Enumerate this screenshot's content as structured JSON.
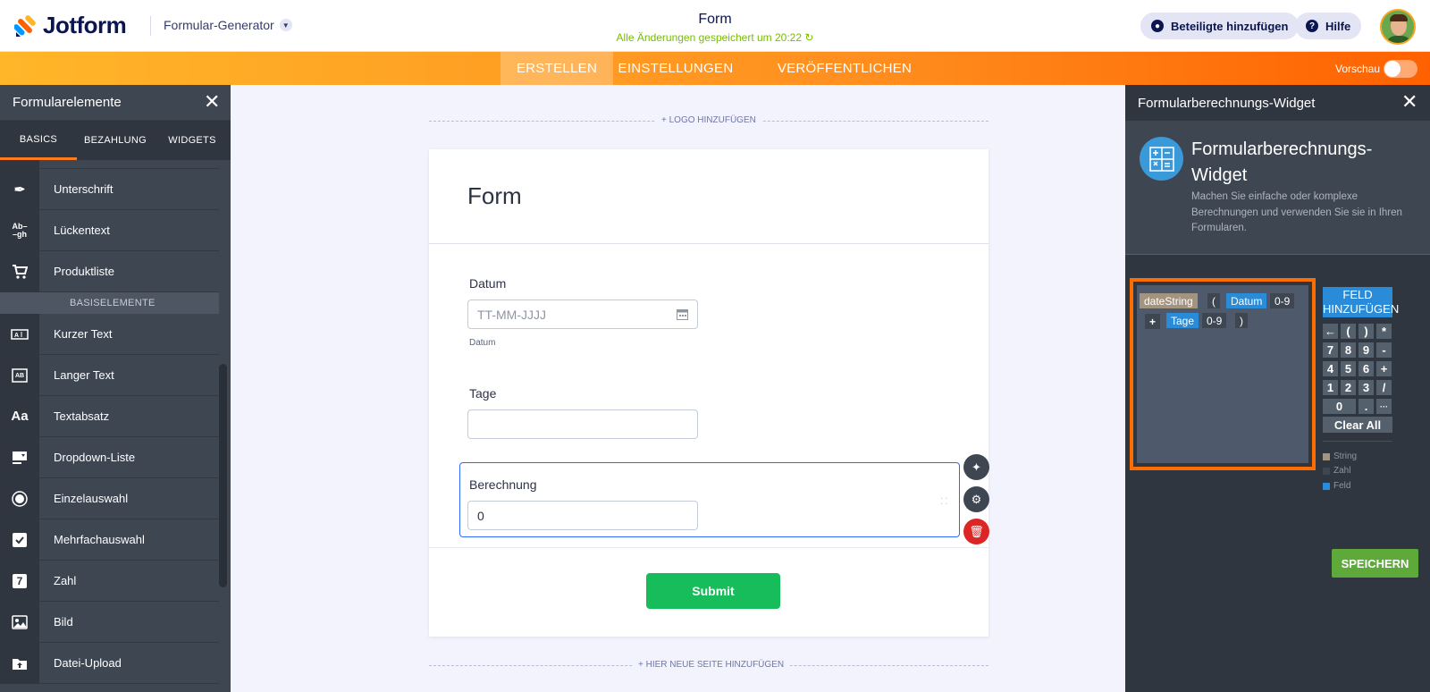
{
  "header": {
    "logo_text": "Jotform",
    "app_switcher": "Formular-Generator",
    "form_title": "Form",
    "save_status": "Alle Änderungen gespeichert um 20:22",
    "invite_label": "Beteiligte hinzufügen",
    "help_label": "Hilfe"
  },
  "nav": {
    "tabs": [
      "ERSTELLEN",
      "EINSTELLUNGEN",
      "VERÖFFENTLICHEN"
    ],
    "active_tab": "ERSTELLEN",
    "preview_label": "Vorschau",
    "preview_enabled": false
  },
  "left_panel": {
    "title": "Formularelemente",
    "tabs": [
      "BASICS",
      "BEZAHLUNG",
      "WIDGETS"
    ],
    "items_top": [
      {
        "label": "Unterschrift",
        "icon": "signature-icon"
      },
      {
        "label": "Lückentext",
        "icon": "fill-blank-icon"
      },
      {
        "label": "Produktliste",
        "icon": "cart-icon"
      }
    ],
    "section": "BASISELEMENTE",
    "items": [
      {
        "label": "Kurzer Text",
        "icon": "short-text-icon"
      },
      {
        "label": "Langer Text",
        "icon": "long-text-icon"
      },
      {
        "label": "Textabsatz",
        "icon": "paragraph-icon"
      },
      {
        "label": "Dropdown-Liste",
        "icon": "dropdown-icon"
      },
      {
        "label": "Einzelauswahl",
        "icon": "radio-icon"
      },
      {
        "label": "Mehrfachauswahl",
        "icon": "checkbox-icon"
      },
      {
        "label": "Zahl",
        "icon": "number-icon"
      },
      {
        "label": "Bild",
        "icon": "image-icon"
      },
      {
        "label": "Datei-Upload",
        "icon": "upload-icon"
      }
    ]
  },
  "canvas": {
    "add_logo": "+ LOGO HINZUFÜGEN",
    "add_page": "+ HIER NEUE SEITE HINZUFÜGEN",
    "form_heading": "Form",
    "fields": {
      "datum": {
        "label": "Datum",
        "placeholder": "TT-MM-JJJJ",
        "sublabel": "Datum"
      },
      "tage": {
        "label": "Tage",
        "value": ""
      },
      "berechnung": {
        "label": "Berechnung",
        "value": "0"
      }
    },
    "submit": "Submit"
  },
  "right_panel": {
    "title": "Formularberechnungs-Widget",
    "widget_title": "Formularberechnungs-Widget",
    "widget_desc": "Machen Sie einfache oder komplexe Berechnungen und verwenden Sie sie in Ihren Formularen.",
    "formula": {
      "tok_datestring": "dateString",
      "tok_open": "(",
      "tok_datum": "Datum",
      "tok_num1": "0-9",
      "tok_plus": "+",
      "tok_tage": "Tage",
      "tok_num2": "0-9",
      "tok_close": ")"
    },
    "add_field_label": "FELD HINZUFÜGEN",
    "keys": [
      "←",
      "(",
      ")",
      "*",
      "7",
      "8",
      "9",
      "-",
      "4",
      "5",
      "6",
      "+",
      "1",
      "2",
      "3",
      "/",
      "0",
      ".",
      "···"
    ],
    "clear_all": "Clear All",
    "legend": [
      {
        "label": "String",
        "color": "#a39480"
      },
      {
        "label": "Zahl",
        "color": "#3e4652"
      },
      {
        "label": "Feld",
        "color": "#2a8cd8"
      }
    ],
    "save_label": "SPEICHERN"
  },
  "colors": {
    "brand_orange": "#ff6100",
    "submit_green": "#18bd5b",
    "field_blue": "#2a8cd8",
    "save_green": "#5da93a"
  }
}
